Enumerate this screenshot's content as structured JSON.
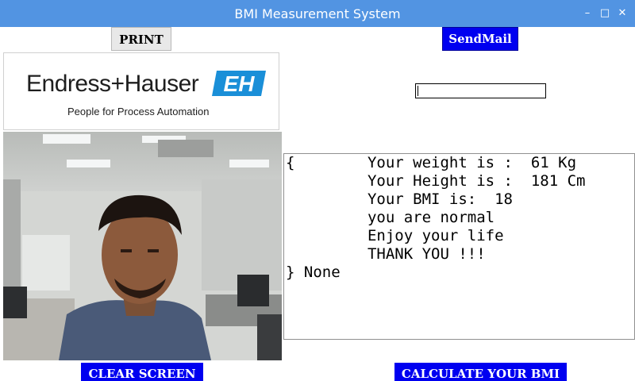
{
  "window": {
    "title": "BMI Measurement System",
    "controls": {
      "minimize": "–",
      "maximize": "□",
      "close": "✕"
    }
  },
  "toolbar": {
    "print_label": "PRINT",
    "sendmail_label": "SendMail"
  },
  "logo": {
    "company": "Endress+Hauser",
    "tagline": "People for Process Automation",
    "mark_text": "EH",
    "mark_color": "#1a8fd8"
  },
  "input": {
    "value": ""
  },
  "output": {
    "lines": [
      "{        Your weight is :  61 Kg",
      "         Your Height is :  181 Cm",
      "         Your BMI is:  18",
      "         you are normal",
      "         Enjoy your life",
      "         THANK YOU !!!",
      "} None"
    ]
  },
  "buttons": {
    "clear_label": "CLEAR SCREEN",
    "calculate_label": "CALCULATE YOUR BMI"
  },
  "colors": {
    "titlebar": "#5294e2",
    "button_blue": "#0000f0"
  }
}
